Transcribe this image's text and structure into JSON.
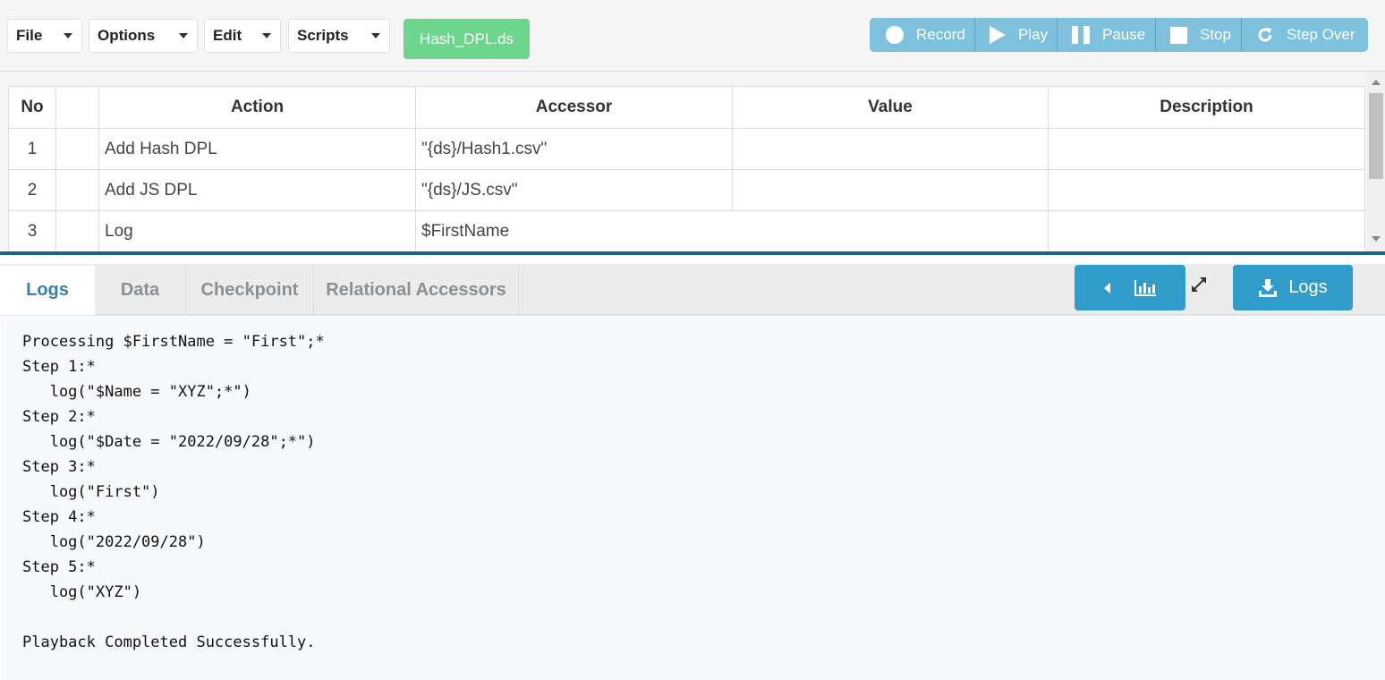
{
  "toolbar": {
    "menus": [
      "File",
      "Options",
      "Edit",
      "Scripts"
    ],
    "script_name": "Hash_DPL.ds",
    "playback": {
      "record": "Record",
      "play": "Play",
      "pause": "Pause",
      "stop": "Stop",
      "step_over": "Step Over"
    }
  },
  "table": {
    "headers": [
      "No",
      "",
      "Action",
      "Accessor",
      "Value",
      "Description"
    ],
    "rows": [
      {
        "no": "1",
        "flag": "",
        "action": "Add Hash DPL",
        "accessor": "\"{ds}/Hash1.csv\"",
        "value": "",
        "description": ""
      },
      {
        "no": "2",
        "flag": "",
        "action": "Add JS DPL",
        "accessor": "\"{ds}/JS.csv\"",
        "value": "",
        "description": ""
      },
      {
        "no": "3",
        "flag": "",
        "action": "Log",
        "accessor": "$FirstName",
        "value": "",
        "description": ""
      }
    ]
  },
  "bottom": {
    "tabs": [
      "Logs",
      "Data",
      "Checkpoint",
      "Relational Accessors"
    ],
    "active_tab": "Logs",
    "logs_button": "Logs",
    "log_lines": [
      "Processing $FirstName = \"First\";*",
      "Step 1:*",
      "   log(\"$Name = \"XYZ\";*\")",
      "Step 2:*",
      "   log(\"$Date = \"2022/09/28\";*\")",
      "Step 3:*",
      "   log(\"First\")",
      "Step 4:*",
      "   log(\"2022/09/28\")",
      "Step 5:*",
      "   log(\"XYZ\")",
      "",
      "Playback Completed Successfully."
    ]
  },
  "colors": {
    "script_badge": "#6bd68c",
    "playbar": "#7ec1dc",
    "primary_button": "#2f9cc9",
    "divider": "#1e6380",
    "active_tab_text": "#3a7fa8"
  },
  "icons": {
    "record": "record-circle-icon",
    "play": "play-icon",
    "pause": "pause-icon",
    "stop": "stop-icon",
    "step_over": "redo-icon",
    "chart": "bar-chart-icon",
    "expand": "expand-arrows-icon",
    "download": "download-icon"
  }
}
